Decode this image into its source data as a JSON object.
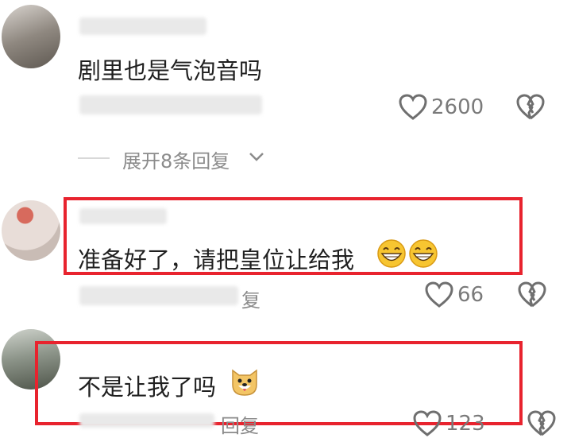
{
  "comments": [
    {
      "text": "剧里也是气泡音吗",
      "likes": "2600",
      "expand_replies": "展开8条回复"
    },
    {
      "text": "准备好了，请把皇位让给我",
      "emoji": [
        "grin-emoji",
        "grin-emoji"
      ],
      "reply_label": "复",
      "likes": "66"
    },
    {
      "text": "不是让我了吗",
      "emoji": [
        "dog-face-emoji"
      ],
      "reply_label": "回复",
      "likes": "123"
    }
  ],
  "colors": {
    "highlight_box": "#e8232e",
    "muted_text": "#8b8b8b",
    "icon_gray": "#6f6f6f"
  }
}
